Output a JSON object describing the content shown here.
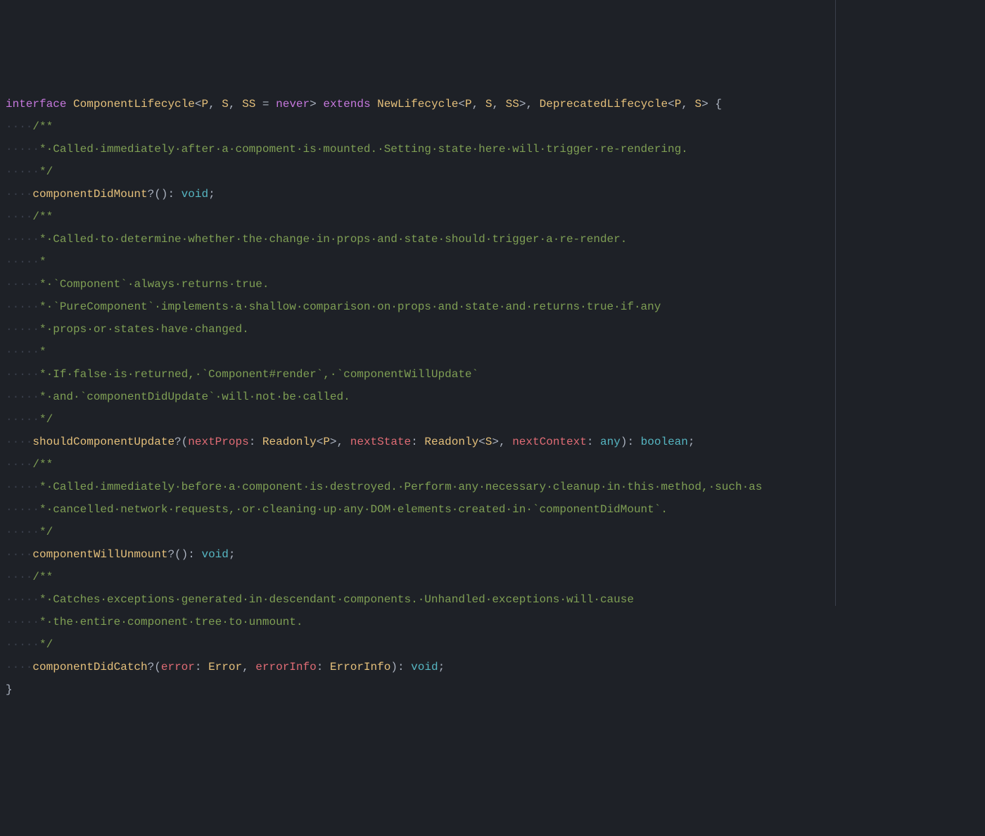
{
  "ruler_column": 120,
  "lines": [
    {
      "spans": [
        {
          "t": "",
          "c": "ws"
        },
        {
          "t": "interface",
          "c": "kw"
        },
        {
          "t": " ",
          "c": "ws"
        },
        {
          "t": "ComponentLifecycle",
          "c": "typename"
        },
        {
          "t": "<",
          "c": "punct"
        },
        {
          "t": "P",
          "c": "typeparam"
        },
        {
          "t": ", ",
          "c": "punct"
        },
        {
          "t": "S",
          "c": "typeparam"
        },
        {
          "t": ", ",
          "c": "punct"
        },
        {
          "t": "SS",
          "c": "typeparam"
        },
        {
          "t": " = ",
          "c": "punct"
        },
        {
          "t": "never",
          "c": "typekw"
        },
        {
          "t": ">",
          "c": "punct"
        },
        {
          "t": " ",
          "c": "ws"
        },
        {
          "t": "extends",
          "c": "kw"
        },
        {
          "t": " ",
          "c": "ws"
        },
        {
          "t": "NewLifecycle",
          "c": "typename"
        },
        {
          "t": "<",
          "c": "punct"
        },
        {
          "t": "P",
          "c": "typeparam"
        },
        {
          "t": ", ",
          "c": "punct"
        },
        {
          "t": "S",
          "c": "typeparam"
        },
        {
          "t": ", ",
          "c": "punct"
        },
        {
          "t": "SS",
          "c": "typeparam"
        },
        {
          "t": ">",
          "c": "punct"
        },
        {
          "t": ", ",
          "c": "punct"
        },
        {
          "t": "DeprecatedLifecycle",
          "c": "typename"
        },
        {
          "t": "<",
          "c": "punct"
        },
        {
          "t": "P",
          "c": "typeparam"
        },
        {
          "t": ", ",
          "c": "punct"
        },
        {
          "t": "S",
          "c": "typeparam"
        },
        {
          "t": ">",
          "c": "punct"
        },
        {
          "t": " {",
          "c": "punct"
        }
      ]
    },
    {
      "spans": [
        {
          "t": "····",
          "c": "ws"
        },
        {
          "t": "/**",
          "c": "comment"
        }
      ]
    },
    {
      "spans": [
        {
          "t": "·····",
          "c": "ws"
        },
        {
          "t": "*·Called·immediately·after·a·compoment·is·mounted.·Setting·state·here·will·trigger·re-rendering.",
          "c": "comment"
        }
      ]
    },
    {
      "spans": [
        {
          "t": "·····",
          "c": "ws"
        },
        {
          "t": "*/",
          "c": "comment"
        }
      ]
    },
    {
      "spans": [
        {
          "t": "····",
          "c": "ws"
        },
        {
          "t": "componentDidMount",
          "c": "method"
        },
        {
          "t": "?",
          "c": "punct"
        },
        {
          "t": "():",
          "c": "punct"
        },
        {
          "t": " ",
          "c": "ws"
        },
        {
          "t": "void",
          "c": "typevoid"
        },
        {
          "t": ";",
          "c": "punct"
        }
      ]
    },
    {
      "spans": [
        {
          "t": "····",
          "c": "ws"
        },
        {
          "t": "/**",
          "c": "comment"
        }
      ]
    },
    {
      "spans": [
        {
          "t": "·····",
          "c": "ws"
        },
        {
          "t": "*·Called·to·determine·whether·the·change·in·props·and·state·should·trigger·a·re-render.",
          "c": "comment"
        }
      ]
    },
    {
      "spans": [
        {
          "t": "·····",
          "c": "ws"
        },
        {
          "t": "*",
          "c": "comment"
        }
      ]
    },
    {
      "spans": [
        {
          "t": "·····",
          "c": "ws"
        },
        {
          "t": "*·`Component`·always·returns·true.",
          "c": "comment"
        }
      ]
    },
    {
      "spans": [
        {
          "t": "·····",
          "c": "ws"
        },
        {
          "t": "*·`PureComponent`·implements·a·shallow·comparison·on·props·and·state·and·returns·true·if·any",
          "c": "comment"
        }
      ]
    },
    {
      "spans": [
        {
          "t": "·····",
          "c": "ws"
        },
        {
          "t": "*·props·or·states·have·changed.",
          "c": "comment"
        }
      ]
    },
    {
      "spans": [
        {
          "t": "·····",
          "c": "ws"
        },
        {
          "t": "*",
          "c": "comment"
        }
      ]
    },
    {
      "spans": [
        {
          "t": "·····",
          "c": "ws"
        },
        {
          "t": "*·If·false·is·returned,·`Component#render`,·`componentWillUpdate`",
          "c": "comment"
        }
      ]
    },
    {
      "spans": [
        {
          "t": "·····",
          "c": "ws"
        },
        {
          "t": "*·and·`componentDidUpdate`·will·not·be·called.",
          "c": "comment"
        }
      ]
    },
    {
      "spans": [
        {
          "t": "·····",
          "c": "ws"
        },
        {
          "t": "*/",
          "c": "comment"
        }
      ]
    },
    {
      "spans": [
        {
          "t": "····",
          "c": "ws"
        },
        {
          "t": "shouldComponentUpdate",
          "c": "method"
        },
        {
          "t": "?",
          "c": "punct"
        },
        {
          "t": "(",
          "c": "punct"
        },
        {
          "t": "nextProps",
          "c": "param"
        },
        {
          "t": ": ",
          "c": "punct"
        },
        {
          "t": "Readonly",
          "c": "typename"
        },
        {
          "t": "<",
          "c": "punct"
        },
        {
          "t": "P",
          "c": "typeparam"
        },
        {
          "t": ">",
          "c": "punct"
        },
        {
          "t": ", ",
          "c": "punct"
        },
        {
          "t": "nextState",
          "c": "param"
        },
        {
          "t": ": ",
          "c": "punct"
        },
        {
          "t": "Readonly",
          "c": "typename"
        },
        {
          "t": "<",
          "c": "punct"
        },
        {
          "t": "S",
          "c": "typeparam"
        },
        {
          "t": ">",
          "c": "punct"
        },
        {
          "t": ", ",
          "c": "punct"
        },
        {
          "t": "nextContext",
          "c": "param"
        },
        {
          "t": ": ",
          "c": "punct"
        },
        {
          "t": "any",
          "c": "typevoid"
        },
        {
          "t": "):",
          "c": "punct"
        },
        {
          "t": " ",
          "c": "ws"
        },
        {
          "t": "boolean",
          "c": "typevoid"
        },
        {
          "t": ";",
          "c": "punct"
        }
      ]
    },
    {
      "spans": [
        {
          "t": "····",
          "c": "ws"
        },
        {
          "t": "/**",
          "c": "comment"
        }
      ]
    },
    {
      "spans": [
        {
          "t": "·····",
          "c": "ws"
        },
        {
          "t": "*·Called·immediately·before·a·component·is·destroyed.·Perform·any·necessary·cleanup·in·this·method,·such·as",
          "c": "comment"
        }
      ]
    },
    {
      "spans": [
        {
          "t": "·····",
          "c": "ws"
        },
        {
          "t": "*·cancelled·network·requests,·or·cleaning·up·any·DOM·elements·created·in·`componentDidMount`.",
          "c": "comment"
        }
      ]
    },
    {
      "spans": [
        {
          "t": "·····",
          "c": "ws"
        },
        {
          "t": "*/",
          "c": "comment"
        }
      ]
    },
    {
      "spans": [
        {
          "t": "····",
          "c": "ws"
        },
        {
          "t": "componentWillUnmount",
          "c": "method"
        },
        {
          "t": "?",
          "c": "punct"
        },
        {
          "t": "():",
          "c": "punct"
        },
        {
          "t": " ",
          "c": "ws"
        },
        {
          "t": "void",
          "c": "typevoid"
        },
        {
          "t": ";",
          "c": "punct"
        }
      ]
    },
    {
      "spans": [
        {
          "t": "····",
          "c": "ws"
        },
        {
          "t": "/**",
          "c": "comment"
        }
      ]
    },
    {
      "spans": [
        {
          "t": "·····",
          "c": "ws"
        },
        {
          "t": "*·Catches·exceptions·generated·in·descendant·components.·Unhandled·exceptions·will·cause",
          "c": "comment"
        }
      ]
    },
    {
      "spans": [
        {
          "t": "·····",
          "c": "ws"
        },
        {
          "t": "*·the·entire·component·tree·to·unmount.",
          "c": "comment"
        }
      ]
    },
    {
      "spans": [
        {
          "t": "·····",
          "c": "ws"
        },
        {
          "t": "*/",
          "c": "comment"
        }
      ]
    },
    {
      "spans": [
        {
          "t": "····",
          "c": "ws"
        },
        {
          "t": "componentDidCatch",
          "c": "method"
        },
        {
          "t": "?",
          "c": "punct"
        },
        {
          "t": "(",
          "c": "punct"
        },
        {
          "t": "error",
          "c": "param"
        },
        {
          "t": ": ",
          "c": "punct"
        },
        {
          "t": "Error",
          "c": "typename"
        },
        {
          "t": ", ",
          "c": "punct"
        },
        {
          "t": "errorInfo",
          "c": "param"
        },
        {
          "t": ": ",
          "c": "punct"
        },
        {
          "t": "ErrorInfo",
          "c": "typename"
        },
        {
          "t": "):",
          "c": "punct"
        },
        {
          "t": " ",
          "c": "ws"
        },
        {
          "t": "void",
          "c": "typevoid"
        },
        {
          "t": ";",
          "c": "punct"
        }
      ]
    },
    {
      "spans": [
        {
          "t": "}",
          "c": "punct"
        }
      ]
    }
  ]
}
